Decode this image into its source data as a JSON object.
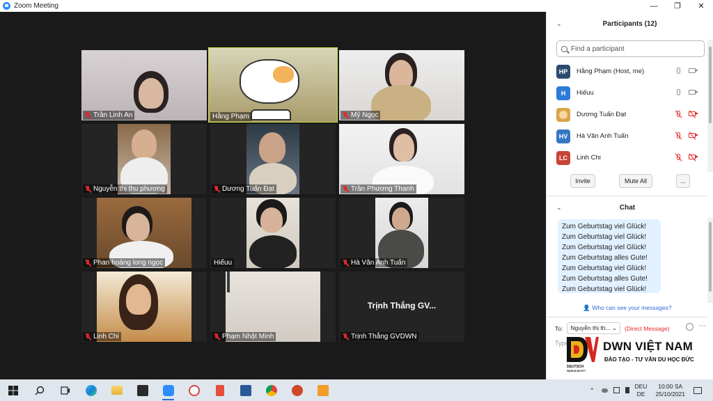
{
  "window": {
    "title": "Zoom Meeting",
    "minimize": "—",
    "maximize": "❐",
    "close": "✕"
  },
  "tiles": [
    {
      "name": "Trần Linh An",
      "muted": true
    },
    {
      "name": "Hằng Phạm",
      "muted": false,
      "active": true
    },
    {
      "name": "Mỹ Ngọc",
      "muted": true
    },
    {
      "name": "Nguyễn thị thu phương",
      "muted": true
    },
    {
      "name": "Dương Tuấn Đạt",
      "muted": true
    },
    {
      "name": "Trần Phương Thanh",
      "muted": true
    },
    {
      "name": "Phan hoàng long ngọc",
      "muted": true
    },
    {
      "name": "Hiếuu",
      "muted": false
    },
    {
      "name": "Hà Văn Anh Tuấn",
      "muted": true
    },
    {
      "name": "Linh Chi",
      "muted": true
    },
    {
      "name": "Phạm Nhật Minh",
      "muted": true
    },
    {
      "name": "Trịnh Thắng GVDWN",
      "muted": true,
      "display_text": "Trịnh Thắng GV..."
    }
  ],
  "participants_panel": {
    "title": "Participants (12)",
    "search_placeholder": "Find a participant",
    "participants": [
      {
        "initials": "HP",
        "name": "Hằng Phạm (Host, me)",
        "color": "#2b4a6f",
        "mic_off": false,
        "cam_off": false
      },
      {
        "initials": "H",
        "name": "Hiếuu",
        "color": "#2d7bd8",
        "mic_off": false,
        "cam_off": false
      },
      {
        "initials": "",
        "name": "Dương Tuấn Đạt",
        "color": "#d9a44b",
        "mic_off": true,
        "cam_off": true
      },
      {
        "initials": "HV",
        "name": "Hà Văn Anh Tuấn",
        "color": "#3576c4",
        "mic_off": true,
        "cam_off": true
      },
      {
        "initials": "LC",
        "name": "Linh Chi",
        "color": "#c84436",
        "mic_off": true,
        "cam_off": true
      }
    ],
    "invite_label": "Invite",
    "mute_all_label": "Mute All",
    "more_label": "..."
  },
  "chat": {
    "title": "Chat",
    "messages": [
      "Zum Geburtstag viel Glück!",
      "Zum Geburtstag viel Glück!",
      "Zum Geburtstag viel Glück!",
      "Zum Geburtstag alles Gute!",
      "Zum Geburtstag viel Glück!",
      "Zum Geburtstag alles Gute!",
      "Zum Geburtstag viel Glück!"
    ],
    "visibility_link": "Who can see your messages?",
    "to_label": "To:",
    "recipient": "Nguyễn thị th...",
    "direct_label": "(Direct Message)",
    "input_placeholder": "Type"
  },
  "watermark": {
    "brand": "DWN VIỆT NAM",
    "tagline": "ĐÀO TẠO - TƯ VẤN DU HỌC ĐỨC",
    "logo_text": "DEUTSCH",
    "logo_subtext": "WARUM NICHT?"
  },
  "taskbar": {
    "icons": [
      "windows-start-icon",
      "search-icon",
      "task-view-icon",
      "edge-icon",
      "file-explorer-icon",
      "store-icon",
      "zoom-icon",
      "paint-icon",
      "snipping-icon",
      "word-icon",
      "chrome-icon",
      "powerpoint-icon",
      "media-icon"
    ],
    "lang_top": "DEU",
    "lang_bottom": "DE",
    "time": "10:00 SA",
    "date": "25/10/2021"
  }
}
